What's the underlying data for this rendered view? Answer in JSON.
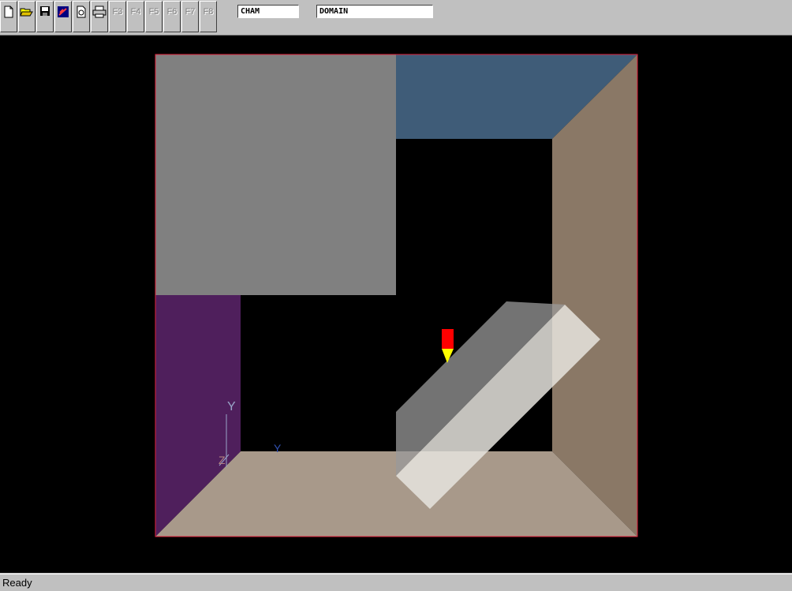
{
  "toolbar": {
    "buttons": [
      {
        "name": "new-file",
        "icon": "new-file-icon"
      },
      {
        "name": "open",
        "icon": "open-folder-icon"
      },
      {
        "name": "save",
        "icon": "floppy-disk-icon"
      },
      {
        "name": "draw",
        "icon": "draw-tool-icon"
      },
      {
        "name": "refresh",
        "icon": "refresh-page-icon"
      },
      {
        "name": "print",
        "icon": "printer-icon"
      }
    ],
    "function_keys": [
      "F3",
      "F4",
      "F5",
      "F6",
      "F7",
      "F8"
    ],
    "field1_value": "CHAM",
    "field2_value": "DOMAIN"
  },
  "viewport": {
    "axis_y_label": "Y",
    "axis_z_label": "Z",
    "marker_label": "Y",
    "colors": {
      "background": "#000000",
      "top_left_block": "#808080",
      "top_right_panel": "#3f5c78",
      "right_wall": "#8a7866",
      "bottom_floor": "#a8998a",
      "left_wall": "#4f1f5c",
      "tilted_block": "#c8c6c0",
      "domain_outline": "#e0203a",
      "probe_red": "#ff0000",
      "probe_yellow": "#ffff00"
    }
  },
  "status": {
    "text": "Ready"
  }
}
